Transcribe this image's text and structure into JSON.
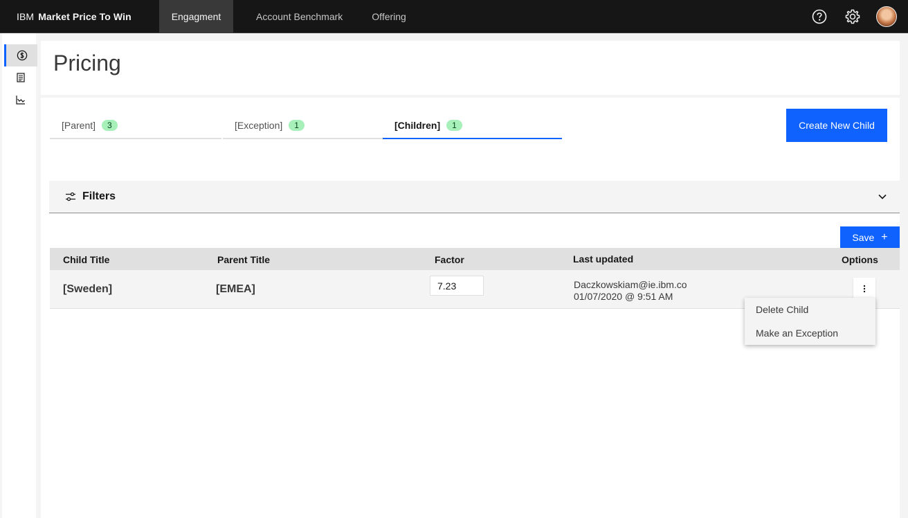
{
  "header": {
    "brand_prefix": "IBM",
    "brand_name": "Market Price To Win",
    "nav": [
      {
        "label": "Engagment",
        "active": true
      },
      {
        "label": "Account Benchmark",
        "active": false
      },
      {
        "label": "Offering",
        "active": false
      }
    ],
    "icons": [
      "help-icon",
      "settings-icon",
      "user-avatar"
    ]
  },
  "sidebar": {
    "items": [
      {
        "icon": "currency-icon",
        "active": true
      },
      {
        "icon": "list-icon",
        "active": false
      },
      {
        "icon": "chart-icon",
        "active": false
      }
    ]
  },
  "page": {
    "title": "Pricing"
  },
  "tabs": [
    {
      "label": "[Parent]",
      "count": "3",
      "active": false
    },
    {
      "label": "[Exception]",
      "count": "1",
      "active": false
    },
    {
      "label": "[Children]",
      "count": "1",
      "active": true
    }
  ],
  "actions": {
    "create_label": "Create New Child",
    "save_label": "Save"
  },
  "filters": {
    "label": "Filters"
  },
  "table": {
    "headers": {
      "child_title": "Child Title",
      "parent_title": "Parent Title",
      "factor": "Factor",
      "last_updated": "Last updated",
      "options": "Options"
    },
    "rows": [
      {
        "child_title": "[Sweden]",
        "parent_title": "[EMEA]",
        "factor": "7.23",
        "updated_by": "Daczkowskiam@ie.ibm.co",
        "updated_at": "01/07/2020 @ 9:51 AM"
      }
    ]
  },
  "overflow_menu": {
    "items": [
      "Delete Child",
      "Make an Exception"
    ]
  },
  "colors": {
    "accent": "#0f62fe",
    "header_bg": "#161616",
    "badge_bg": "#a7f0ba"
  }
}
